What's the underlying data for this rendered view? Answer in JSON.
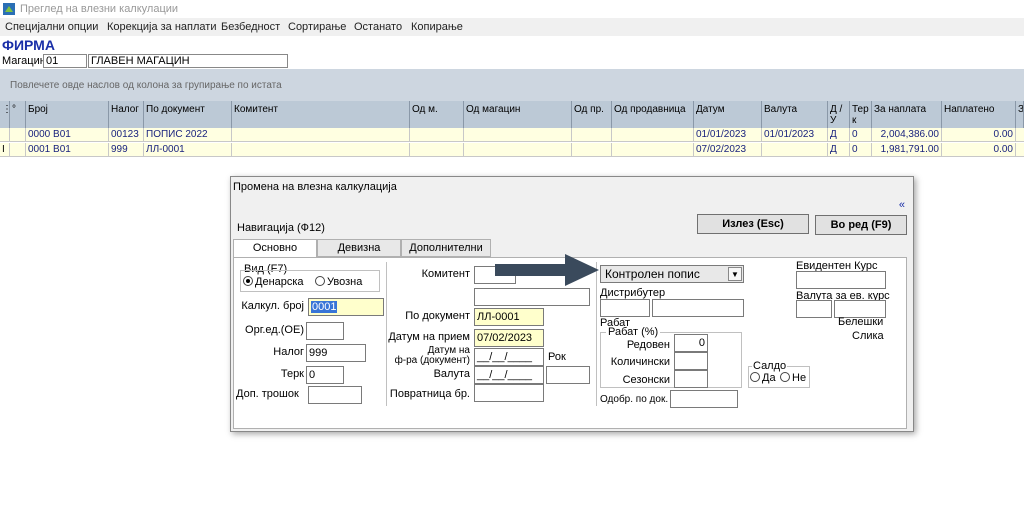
{
  "window": {
    "title": "Преглед на влезни калкулации"
  },
  "menu": [
    "Специјални опции",
    "Корекција за наплати",
    "Безбедност",
    "Сортирање",
    "Останато",
    "Копирање"
  ],
  "header": {
    "firma": "ФИРМА",
    "magacin_label": "Магацин",
    "magacin_code": "01",
    "magacin_name": "ГЛАВЕН МАГАЦИН"
  },
  "group_hint": "Повлечете овде наслов од колона за групирање по истата",
  "columns": [
    "Број",
    "Налог",
    "По документ",
    "Комитент",
    "Од м.",
    "Од магацин",
    "Од пр.",
    "Од продавница",
    "Датум",
    "Валута",
    "Д / У",
    "Тер к",
    "За наплата",
    "Наплатено",
    "З"
  ],
  "rows": [
    {
      "broj": "0000   В01",
      "nalog": "00123",
      "po_dok": "ПОПИС 2022",
      "datum": "01/01/2023",
      "valuta": "01/01/2023",
      "du": "Д",
      "terk": "0",
      "za_naplata": "2,004,386.00",
      "naplateno": "0.00"
    },
    {
      "broj": "0001   В01",
      "nalog": "999",
      "po_dok": "ЛЛ-0001",
      "datum": "07/02/2023",
      "valuta": "",
      "du": "Д",
      "terk": "0",
      "za_naplata": "1,981,791.00",
      "naplateno": "0.00"
    }
  ],
  "dialog": {
    "title": "Промена на влезна калкулација",
    "collapse": "«",
    "nav": "Навигација (Ф12)",
    "exit_btn": "Излез (Esc)",
    "ok_btn": "Во ред (F9)",
    "tabs": [
      "Основно",
      "Девизна",
      "Дополнителни"
    ],
    "vid_label": "Вид (F7)",
    "vid_opt1": "Денарска",
    "vid_opt2": "Увозна",
    "kalk_label": "Калкул. број",
    "kalk_value": "0001",
    "org_label": "Орг.ед.(ОЕ)",
    "nalog_label": "Налог",
    "nalog_value": "999",
    "terk_label": "Терк",
    "terk_value": "0",
    "dop_label": "Доп. трошок",
    "komitent_label": "Комитент",
    "po_dok_label": "По документ",
    "po_dok_value": "ЛЛ-0001",
    "datum_priem_label": "Датум на прием",
    "datum_priem_value": "07/02/2023",
    "datum_fra_label1": "Датум на",
    "datum_fra_label2": "ф-ра (документ)",
    "datum_fra_value": "__/__/____",
    "rok_label": "Рок",
    "valuta_label": "Валута",
    "valuta_value": "__/__/____",
    "povratnica_label": "Повратница бр.",
    "combo_value": "Контролен попис",
    "distributer_label": "Дистрибутер",
    "rabat_label": "Рабат",
    "rabat_pct_label": "Рабат (%)",
    "redoven_label": "Редовен",
    "redoven_value": "0",
    "kolicinski_label": "Количински",
    "sezonski_label": "Сезонски",
    "odobr_label": "Одобр. по док.",
    "saldo_label": "Салдо",
    "saldo_da": "Да",
    "saldo_ne": "Не",
    "evid_kurs_label": "Евидентен Курс",
    "valuta_ev_label": "Валута за ев. курс",
    "beleski_label": "Белешки",
    "slika_label": "Слика"
  },
  "annotation_color": "#3a4a5c"
}
